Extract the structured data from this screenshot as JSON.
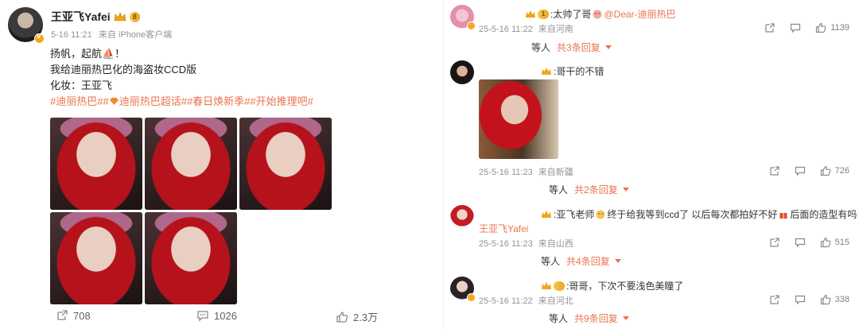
{
  "post": {
    "author": "王亚飞Yafei",
    "vip_level": "8",
    "date": "5-16 11:21",
    "source": "来自 iPhone客户端",
    "text_lines": [
      "扬帆，起航⛵！",
      "我给迪丽热巴化的海盗妆CCD版",
      "化妆：王亚飞"
    ],
    "tags": [
      "#迪丽热巴#",
      "#",
      "迪丽热巴超话#",
      "#春日焕新季#",
      "#开始推理吧#"
    ],
    "photo_count": 5,
    "repost_count": "708",
    "comment_count": "1026",
    "like_count": "2.3万"
  },
  "comments": [
    {
      "badge_level": "1",
      "text": ":太帅了哥",
      "mention": "@Dear-迪丽热巴",
      "date": "25-5-16 11:22",
      "location": "来自河南",
      "likes": "1139",
      "replies_prefix": "等人",
      "replies_count": "共3条回复"
    },
    {
      "text": ":哥干的不错",
      "date": "25-5-16 11:23",
      "location": "来自新疆",
      "likes": "726",
      "replies_prefix": "等人",
      "replies_count": "共2条回复"
    },
    {
      "text": ":亚飞老师",
      "text2": "终于给我等到ccd了  以后每次都拍好不好",
      "text3": "后面的造型有吗",
      "author_reply": "王亚飞Yafei",
      "date": "25-5-16 11:23",
      "location": "来自山西",
      "likes": "515",
      "replies_prefix": "等人",
      "replies_count": "共4条回复"
    },
    {
      "text": ":哥哥，下次不要浅色美瞳了",
      "date": "25-5-16 11:22",
      "location": "来自河北",
      "likes": "338",
      "replies_prefix": "等人",
      "replies_count": "共9条回复"
    }
  ],
  "colors": {
    "accent": "#eb7350",
    "meta": "#939393",
    "gold": "#f6a623"
  }
}
